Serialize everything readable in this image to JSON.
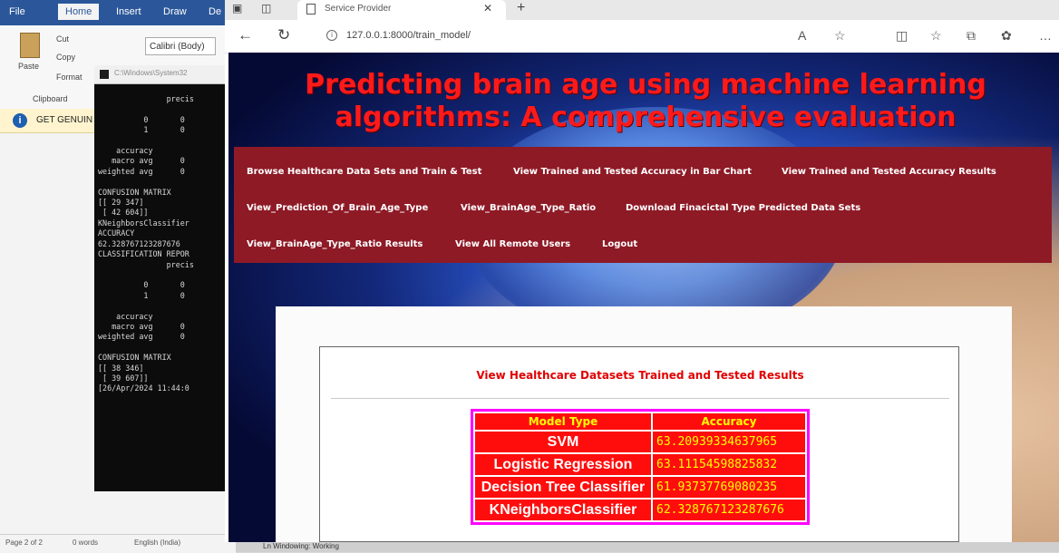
{
  "word": {
    "tabs": [
      "File",
      "Home",
      "Insert",
      "Draw",
      "De"
    ],
    "paste_label": "Paste",
    "cut_label": "Cut",
    "copy_label": "Copy",
    "format_label": "Format",
    "clipboard_label": "Clipboard",
    "font_name": "Calibri (Body)",
    "genuine_text": "GET GENUIN",
    "status": {
      "page": "Page 2 of 2",
      "words": "0 words",
      "language": "English (India)"
    }
  },
  "console": {
    "title": "C:\\Windows\\System32",
    "text": "               precis\n\n          0       0\n          1       0\n\n    accuracy\n   macro avg      0\nweighted avg      0\n\nCONFUSION MATRIX\n[[ 29 347]\n [ 42 604]]\nKNeighborsClassifier\nACCURACY\n62.328767123287676\nCLASSIFICATION REPOR\n               precis\n\n          0       0\n          1       0\n\n    accuracy\n   macro avg      0\nweighted avg      0\n\nCONFUSION MATRIX\n[[ 38 346]\n [ 39 607]]\n[26/Apr/2024 11:44:0"
  },
  "browser": {
    "tab_title": "Service Provider",
    "url": "127.0.0.1:8000/train_model/"
  },
  "page": {
    "title": "Predicting brain age using machine learning algorithms: A comprehensive evaluation",
    "menu": [
      "Browse Healthcare Data Sets and Train & Test",
      "View Trained and Tested Accuracy in Bar Chart",
      "View Trained and Tested Accuracy Results",
      "View_Prediction_Of_Brain_Age_Type",
      "View_BrainAge_Type_Ratio",
      "Download Finacictal Type Predicted Data Sets",
      "View_BrainAge_Type_Ratio Results",
      "View All Remote Users",
      "Logout"
    ],
    "results_title": "View Healthcare Datasets Trained and Tested Results",
    "table": {
      "headers": [
        "Model Type",
        "Accuracy"
      ],
      "rows": [
        [
          "SVM",
          "63.20939334637965"
        ],
        [
          "Logistic Regression",
          "63.11154598825832"
        ],
        [
          "Decision Tree Classifier",
          "61.93737769080235"
        ],
        [
          "KNeighborsClassifier",
          "62.328767123287676"
        ]
      ]
    }
  },
  "taskbar": {
    "text": "Ln Windowing: Working"
  },
  "colors": {
    "title_red": "#ff1a1a",
    "menu_bg": "#8e1a26",
    "table_red": "#ff0d0d",
    "table_border": "#ff00ff",
    "header_yellow": "#ffff00"
  }
}
